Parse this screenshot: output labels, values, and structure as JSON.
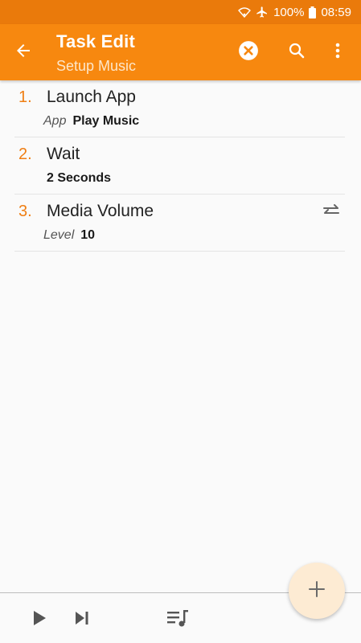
{
  "status_bar": {
    "battery": "100%",
    "time": "08:59",
    "icons": [
      "wifi-icon",
      "airplane-icon",
      "battery-icon"
    ]
  },
  "app_bar": {
    "title": "Task Edit",
    "subtitle": "Setup Music",
    "actions": [
      "back-arrow-icon",
      "clear-icon",
      "search-icon",
      "more-vert-icon"
    ]
  },
  "actions": [
    {
      "number": "1.",
      "name": "Launch App",
      "detail_key": "App",
      "detail_value": "Play Music"
    },
    {
      "number": "2.",
      "name": "Wait",
      "detail_key": "",
      "detail_value": "2 Seconds"
    },
    {
      "number": "3.",
      "name": "Media Volume",
      "detail_key": "Level",
      "detail_value": "10",
      "icon": "swap-icon"
    }
  ],
  "bottom_bar": {
    "icons": [
      "play-icon",
      "skip-next-icon",
      "queue-music-icon"
    ]
  },
  "fab": {
    "icon": "add-icon"
  },
  "colors": {
    "status_bar": "#ea7a0b",
    "app_bar": "#f7880f",
    "accent": "#ef7e14",
    "fab_bg": "#fdebd3"
  }
}
